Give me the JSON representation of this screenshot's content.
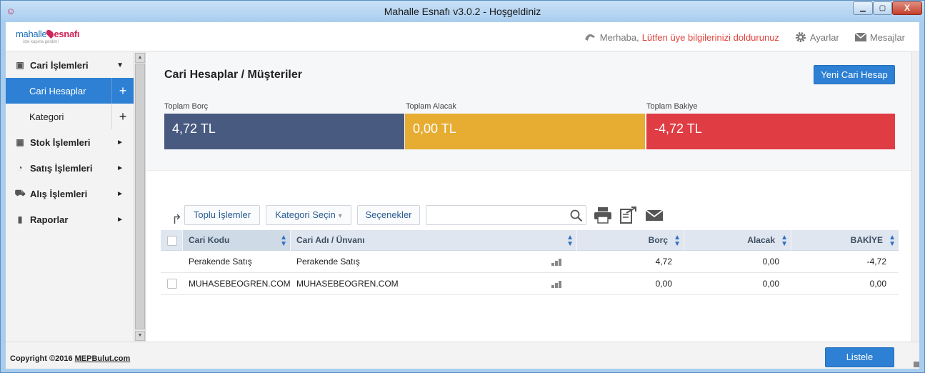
{
  "window": {
    "title": "Mahalle Esnafı v3.0.2 - Hoşgeldiniz",
    "controls": {
      "minimize": "▁",
      "maximize": "▢",
      "close": "X"
    }
  },
  "logo": {
    "part1": "mahalle",
    "part2": "esnafı",
    "tagline": "iste kapına geldim!"
  },
  "header": {
    "greeting": "Merhaba,",
    "notice": "Lütfen üye bilgilerinizi doldurunuz",
    "settings": "Ayarlar",
    "messages": "Mesajlar"
  },
  "sidebar": {
    "sections": [
      {
        "label": "Cari İşlemleri",
        "icon": "contact-card-icon",
        "arrow": "▼"
      },
      {
        "label": "Stok İşlemleri",
        "icon": "box-icon",
        "arrow": "►"
      },
      {
        "label": "Satış İşlemleri",
        "icon": "gauge-icon",
        "arrow": "►"
      },
      {
        "label": "Alış İşlemleri",
        "icon": "cart-icon",
        "arrow": "►"
      },
      {
        "label": "Raporlar",
        "icon": "bar-chart-icon",
        "arrow": "►"
      }
    ],
    "sub_items": [
      {
        "label": "Cari Hesaplar",
        "plus": "+",
        "active": true
      },
      {
        "label": "Kategori",
        "plus": "+",
        "active": false
      }
    ]
  },
  "main": {
    "title": "Cari Hesaplar / Müşteriler",
    "new_button": "Yeni Cari Hesap",
    "stats": [
      {
        "label": "Toplam Borç",
        "value": "4,72 TL",
        "color": "#485a80"
      },
      {
        "label": "Toplam Alacak",
        "value": "0,00 TL",
        "color": "#e6ad32"
      },
      {
        "label": "Toplam Bakiye",
        "value": "-4,72 TL",
        "color": "#e03c44"
      }
    ]
  },
  "toolbar": {
    "bulk_label": "Toplu İşlemler",
    "category_label": "Kategori Seçin",
    "options_label": "Seçenekler",
    "search_value": "",
    "icons": [
      "print-icon",
      "export-icon",
      "mail-icon"
    ]
  },
  "table": {
    "columns": [
      "Cari Kodu",
      "Cari Adı / Ünvanı",
      "Borç",
      "Alacak",
      "BAKİYE"
    ],
    "rows": [
      {
        "code": "Perakende Satış",
        "name": "Perakende Satış",
        "borc": "4,72",
        "alacak": "0,00",
        "bakiye": "-4,72",
        "has_checkbox": false
      },
      {
        "code": "MUHASEBEOGREN.COM",
        "name": "MUHASEBEOGREN.COM",
        "borc": "0,00",
        "alacak": "0,00",
        "bakiye": "0,00",
        "has_checkbox": true
      }
    ]
  },
  "footer": {
    "copyright": "Copyright ©2016",
    "link": "MEPBulut.com",
    "list_button": "Listele"
  },
  "colors": {
    "accent": "#2d80d3",
    "warning_text": "#e0433b"
  }
}
